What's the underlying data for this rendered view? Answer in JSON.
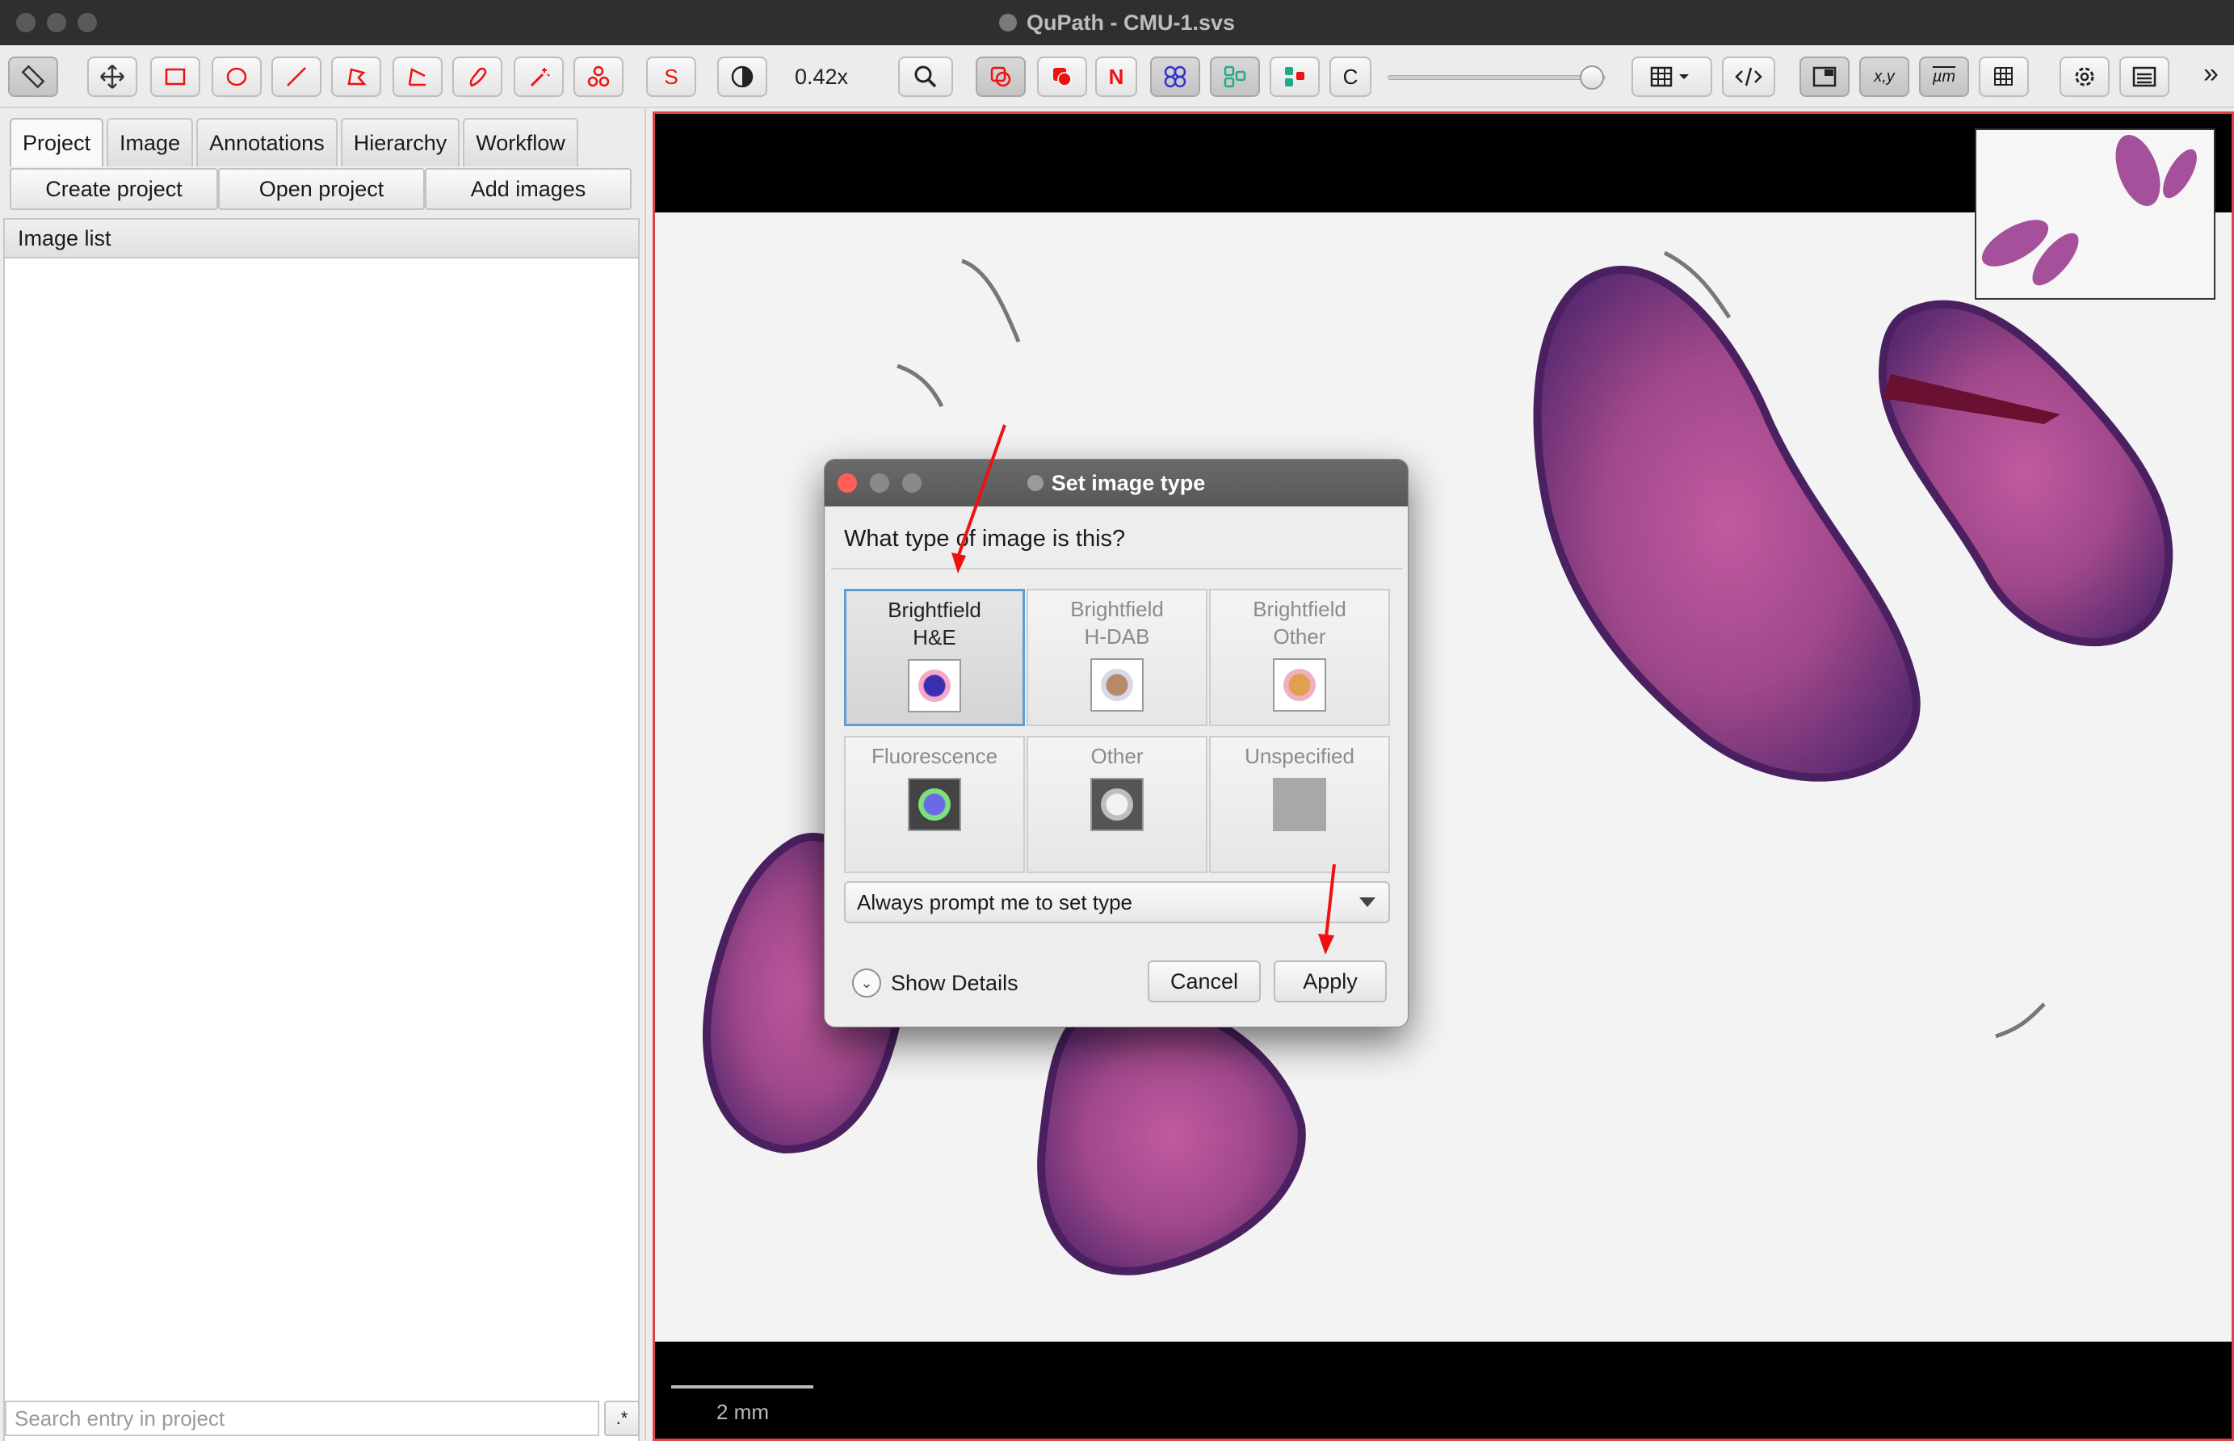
{
  "window": {
    "title": "QuPath - CMU-1.svs"
  },
  "toolbar": {
    "zoom_label": "0.42x",
    "buttons": [
      "S",
      "N",
      "C"
    ],
    "xy_label": "x,y",
    "um_label": "µm",
    "overflow": "»"
  },
  "left_panel": {
    "tabs": [
      "Project",
      "Image",
      "Annotations",
      "Hierarchy",
      "Workflow"
    ],
    "create_project": "Create project",
    "open_project": "Open project",
    "add_images": "Add images",
    "image_list_header": "Image list",
    "search_placeholder": "Search entry in project",
    "regex_button": ".*"
  },
  "viewer": {
    "scale_label": "2 mm"
  },
  "dialog": {
    "title": "Set image type",
    "question": "What type of image is this?",
    "types": [
      {
        "line1": "Brightfield",
        "line2": "H&E",
        "selected": true,
        "inner": "#3a2fb0",
        "outer": "#f5a8c8"
      },
      {
        "line1": "Brightfield",
        "line2": "H-DAB",
        "selected": false,
        "inner": "#b88a6a",
        "outer": "#d8d8e8"
      },
      {
        "line1": "Brightfield",
        "line2": "Other",
        "selected": false,
        "inner": "#e0a050",
        "outer": "#f0b0c0"
      },
      {
        "line1": "Fluorescence",
        "line2": "",
        "selected": false,
        "inner": "#6a6ae8",
        "outer": "#7ee07e"
      },
      {
        "line1": "Other",
        "line2": "",
        "selected": false,
        "inner": "#f2f2f2",
        "outer": "#555555"
      },
      {
        "line1": "Unspecified",
        "line2": "",
        "selected": false,
        "inner": "#a8a8a8",
        "outer": "#a8a8a8"
      }
    ],
    "dropdown_value": "Always prompt me to set type",
    "show_details": "Show Details",
    "cancel": "Cancel",
    "apply": "Apply"
  },
  "colors": {
    "accent_red": "#e11111",
    "selection_blue": "#5e9ed6",
    "tissue_pink": "#c8559a",
    "tissue_purple": "#6a3a8a"
  }
}
